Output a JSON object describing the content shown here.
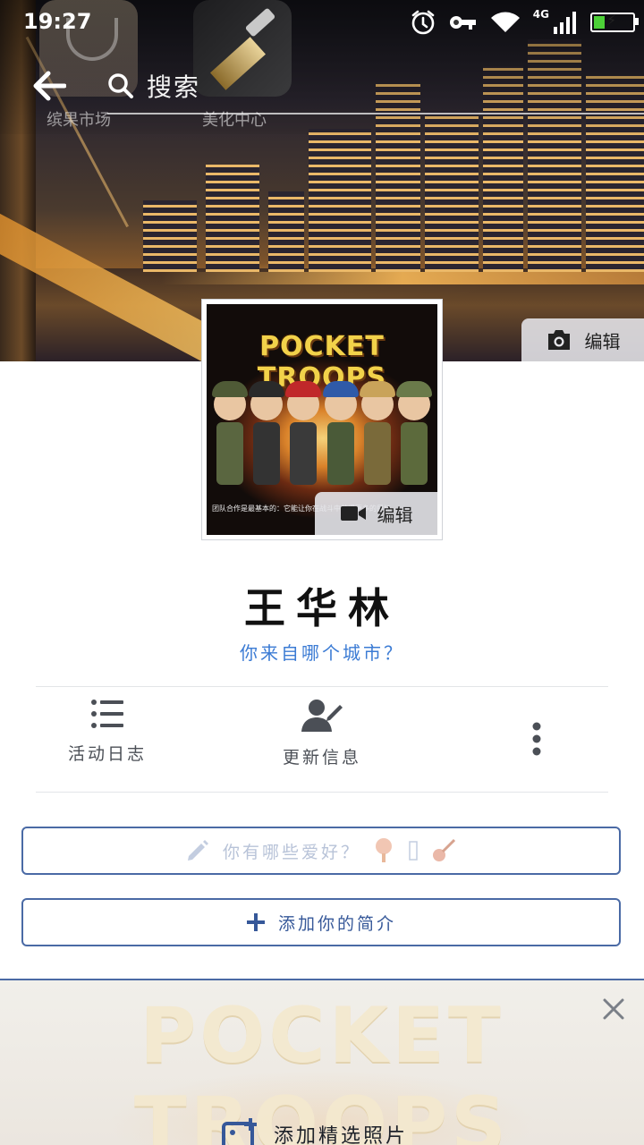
{
  "status_bar": {
    "time": "19:27",
    "network": "4G",
    "battery_level": 0.3,
    "icons": [
      "alarm-icon",
      "vpn-key-icon",
      "wifi-icon",
      "signal-icon",
      "battery-charging-icon"
    ]
  },
  "header": {
    "search_label": "搜索",
    "ghost_app_labels": [
      "缤果市场",
      "美化中心"
    ]
  },
  "cover": {
    "edit_label": "编辑"
  },
  "avatar": {
    "game_title": "POCKET TROOPS",
    "caption": "团队合作是最基本的：它能让你在战斗中获得更多的目标",
    "edit_label": "编辑"
  },
  "profile": {
    "name": "王华林",
    "city_prompt": "你来自哪个城市？"
  },
  "actions": [
    {
      "label": "活动日志",
      "icon": "list-icon"
    },
    {
      "label": "更新信息",
      "icon": "edit-profile-icon"
    },
    {
      "label": "",
      "icon": "more-vertical-icon"
    }
  ],
  "hobbies": {
    "placeholder": "你有哪些爱好？"
  },
  "bio": {
    "label": "添加你的简介"
  },
  "featured": {
    "background_text": "POCKET TROOPS",
    "add_label": "添加精选照片"
  },
  "colors": {
    "accent_blue": "#365899",
    "link_blue": "#3b7bd4",
    "border_blue": "#4a6aa5"
  }
}
